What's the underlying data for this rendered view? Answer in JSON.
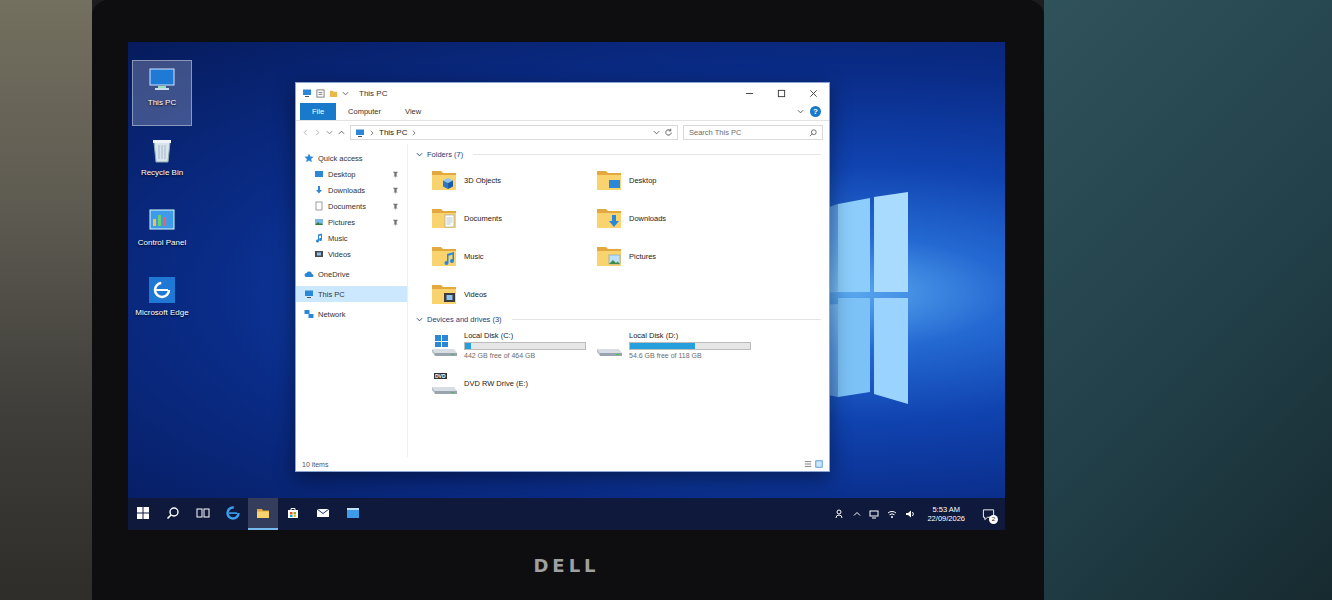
{
  "desktop": {
    "icons": [
      {
        "label": "This PC",
        "kind": "this-pc",
        "selected": true
      },
      {
        "label": "Recycle Bin",
        "kind": "recycle-bin",
        "selected": false
      },
      {
        "label": "Control Panel",
        "kind": "control-panel",
        "selected": false
      },
      {
        "label": "Microsoft Edge",
        "kind": "edge",
        "selected": false
      }
    ]
  },
  "window": {
    "title": "This PC",
    "tabs": [
      {
        "label": "File",
        "kind": "menu",
        "selected": false
      },
      {
        "label": "Computer",
        "kind": "tab",
        "selected": false
      },
      {
        "label": "View",
        "kind": "tab",
        "selected": false
      }
    ],
    "help": "?",
    "address": [
      "This PC"
    ],
    "search": {
      "placeholder": "Search This PC"
    }
  },
  "sidebar": {
    "items": [
      {
        "label": "Quick access",
        "kind": "quick-access",
        "nested": false,
        "pinned": false,
        "selected": false
      },
      {
        "label": "Desktop",
        "kind": "desktop",
        "nested": true,
        "pinned": true,
        "selected": false
      },
      {
        "label": "Downloads",
        "kind": "downloads",
        "nested": true,
        "pinned": true,
        "selected": false
      },
      {
        "label": "Documents",
        "kind": "documents",
        "nested": true,
        "pinned": true,
        "selected": false
      },
      {
        "label": "Pictures",
        "kind": "pictures",
        "nested": true,
        "pinned": true,
        "selected": false
      },
      {
        "label": "Music",
        "kind": "music",
        "nested": true,
        "pinned": false,
        "selected": false
      },
      {
        "label": "Videos",
        "kind": "videos",
        "nested": true,
        "pinned": false,
        "selected": false
      },
      {
        "label": "OneDrive",
        "kind": "onedrive",
        "nested": false,
        "pinned": false,
        "selected": false
      },
      {
        "label": "This PC",
        "kind": "this-pc",
        "nested": false,
        "pinned": false,
        "selected": true
      },
      {
        "label": "Network",
        "kind": "network",
        "nested": false,
        "pinned": false,
        "selected": false
      }
    ]
  },
  "folders": {
    "title": "Folders (7)",
    "items": [
      {
        "label": "3D Objects",
        "kind": "objects"
      },
      {
        "label": "Desktop",
        "kind": "desktop"
      },
      {
        "label": "Documents",
        "kind": "documents"
      },
      {
        "label": "Downloads",
        "kind": "downloads"
      },
      {
        "label": "Music",
        "kind": "music"
      },
      {
        "label": "Pictures",
        "kind": "pictures"
      },
      {
        "label": "Videos",
        "kind": "videos"
      }
    ]
  },
  "drives": {
    "title": "Devices and drives (3)",
    "items": [
      {
        "label": "Local Disk (C:)",
        "kind": "system",
        "free": "442 GB free of 464 GB",
        "level": 0.05
      },
      {
        "label": "Local Disk (D:)",
        "kind": "disk",
        "free": "54.6 GB free of 118 GB",
        "level": 0.54
      },
      {
        "label": "DVD RW Drive (E:)",
        "kind": "dvd",
        "badge": "DVD"
      }
    ]
  },
  "status_bar": {
    "text": "10 items"
  },
  "taskbar": {
    "apps": [
      {
        "kind": "start",
        "active": false
      },
      {
        "kind": "search",
        "active": false
      },
      {
        "kind": "task-view",
        "active": false
      },
      {
        "kind": "edge",
        "active": false
      },
      {
        "kind": "explorer",
        "active": true
      },
      {
        "kind": "store",
        "active": false
      },
      {
        "kind": "mail",
        "active": false
      },
      {
        "kind": "window",
        "active": false
      }
    ],
    "tray": {
      "time": "5:53 AM",
      "date": "22/09/2026",
      "notifications": "2"
    }
  },
  "laptop": {
    "brand": "DELL"
  }
}
